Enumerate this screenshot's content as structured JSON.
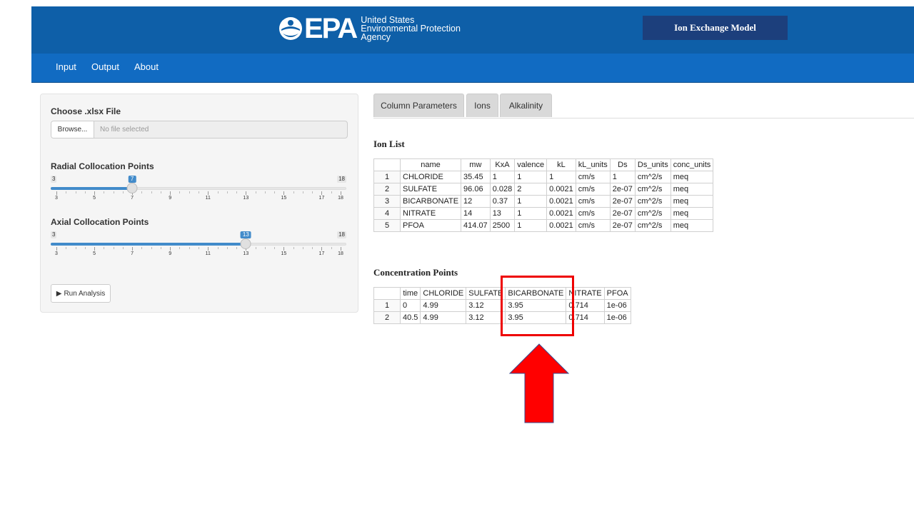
{
  "header": {
    "logo_word": "EPA",
    "logo_line1": "United States",
    "logo_line2": "Environmental Protection",
    "logo_line3": "Agency",
    "model_button": "Ion Exchange Model"
  },
  "nav": {
    "items": [
      "Input",
      "Output",
      "About"
    ]
  },
  "sidebar": {
    "file_label": "Choose .xlsx File",
    "browse_label": "Browse...",
    "file_placeholder": "No file selected",
    "radial": {
      "label": "Radial Collocation Points",
      "min": 3,
      "max": 18,
      "value": 7,
      "tick_labels": [
        "3",
        "5",
        "7",
        "9",
        "11",
        "13",
        "15",
        "17",
        "18"
      ]
    },
    "axial": {
      "label": "Axial Collocation Points",
      "min": 3,
      "max": 18,
      "value": 13,
      "tick_labels": [
        "3",
        "5",
        "7",
        "9",
        "11",
        "13",
        "15",
        "17",
        "18"
      ]
    },
    "run_button": "Run Analysis"
  },
  "tabs": [
    "Column Parameters",
    "Ions",
    "Alkalinity"
  ],
  "ion_list": {
    "title": "Ion List",
    "columns": [
      "",
      "name",
      "mw",
      "KxA",
      "valence",
      "kL",
      "kL_units",
      "Ds",
      "Ds_units",
      "conc_units"
    ],
    "rows": [
      [
        "1",
        "CHLORIDE",
        "35.45",
        "1",
        "1",
        "1",
        "cm/s",
        "1",
        "cm^2/s",
        "meq"
      ],
      [
        "2",
        "SULFATE",
        "96.06",
        "0.028",
        "2",
        "0.0021",
        "cm/s",
        "2e-07",
        "cm^2/s",
        "meq"
      ],
      [
        "3",
        "BICARBONATE",
        "12",
        "0.37",
        "1",
        "0.0021",
        "cm/s",
        "2e-07",
        "cm^2/s",
        "meq"
      ],
      [
        "4",
        "NITRATE",
        "14",
        "13",
        "1",
        "0.0021",
        "cm/s",
        "2e-07",
        "cm^2/s",
        "meq"
      ],
      [
        "5",
        "PFOA",
        "414.07",
        "2500",
        "1",
        "0.0021",
        "cm/s",
        "2e-07",
        "cm^2/s",
        "meq"
      ]
    ]
  },
  "conc_points": {
    "title": "Concentration Points",
    "columns": [
      "",
      "time",
      "CHLORIDE",
      "SULFATE",
      "BICARBONATE",
      "NITRATE",
      "PFOA"
    ],
    "rows": [
      [
        "1",
        "0",
        "4.99",
        "3.12",
        "3.95",
        "0.714",
        "1e-06"
      ],
      [
        "2",
        "40.5",
        "4.99",
        "3.12",
        "3.95",
        "0.714",
        "1e-06"
      ]
    ]
  },
  "annotation": {
    "color": "#ee0000"
  }
}
